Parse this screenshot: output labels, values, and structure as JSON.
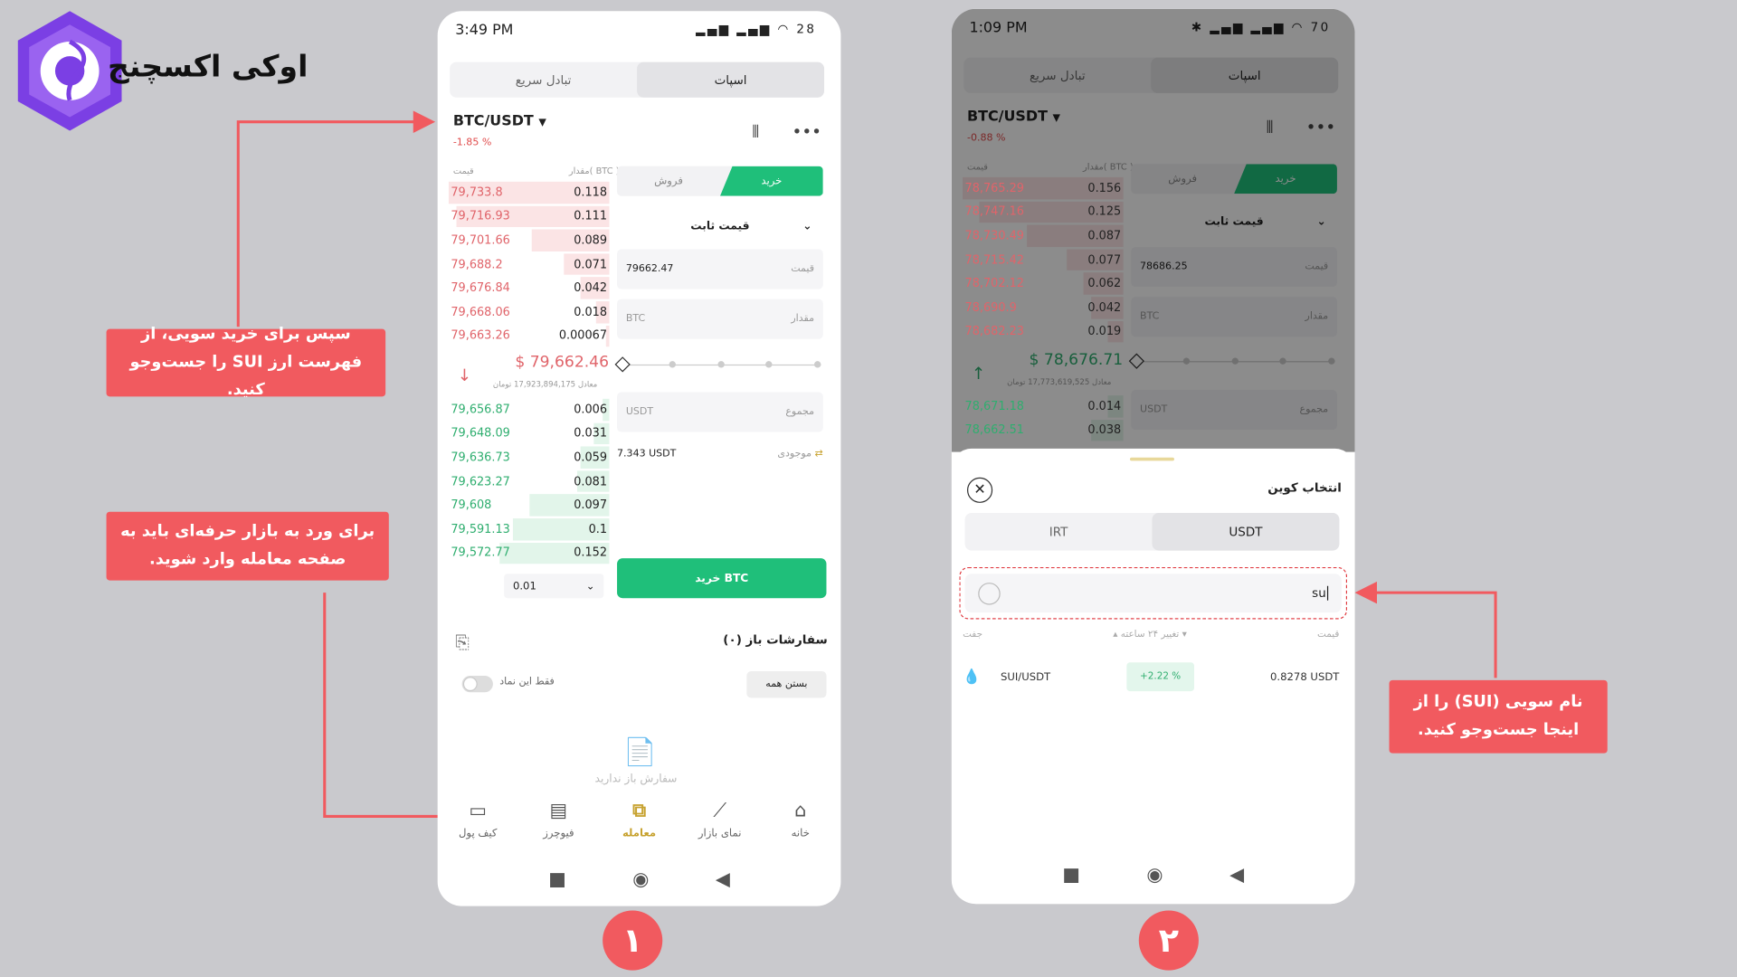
{
  "brand": {
    "name": "اوکی اکسچنج",
    "logo_icon": "okex-hexagon-logo"
  },
  "callouts": {
    "c1": "سپس برای خرید سویی، از فهرست ارز SUI را جست‌وجو کنید.",
    "c2": "برای ورد به بازار حرفه‌ای باید به صفحه معامله وارد شوید.",
    "c3": "نام سویی (SUI) را از اینجا جست‌وجو کنید."
  },
  "steps": {
    "one": "۱",
    "two": "۲"
  },
  "phone1": {
    "time": "3:49 PM",
    "battery": "28",
    "tabs": {
      "spot": "اسپات",
      "quick": "تبادل سریع"
    },
    "pair": "BTC/USDT",
    "change": "-1.85 %",
    "book_header": {
      "price": "قیمت",
      "amount": "مقدار( BTC )"
    },
    "asks": [
      {
        "p": "79,733.8",
        "q": "0.118",
        "w": 100
      },
      {
        "p": "79,716.93",
        "q": "0.111",
        "w": 95
      },
      {
        "p": "79,701.66",
        "q": "0.089",
        "w": 48
      },
      {
        "p": "79,688.2",
        "q": "0.071",
        "w": 28
      },
      {
        "p": "79,676.84",
        "q": "0.042",
        "w": 18
      },
      {
        "p": "79,668.06",
        "q": "0.018",
        "w": 8
      },
      {
        "p": "79,663.26",
        "q": "0.00067",
        "w": 2
      }
    ],
    "mid_price": "$ 79,662.46",
    "mid_sub": "معادل 17,923,894,175 تومان",
    "bids": [
      {
        "p": "79,656.87",
        "q": "0.006",
        "w": 4
      },
      {
        "p": "79,648.09",
        "q": "0.031",
        "w": 10
      },
      {
        "p": "79,636.73",
        "q": "0.059",
        "w": 18
      },
      {
        "p": "79,623.27",
        "q": "0.081",
        "w": 20
      },
      {
        "p": "79,608",
        "q": "0.097",
        "w": 50
      },
      {
        "p": "79,591.13",
        "q": "0.1",
        "w": 60
      },
      {
        "p": "79,572.77",
        "q": "0.152",
        "w": 68
      }
    ],
    "depth": "0.01",
    "trade_tabs": {
      "buy": "خرید",
      "sell": "فروش"
    },
    "order_type": "قیمت ثابت",
    "price_label": "قیمت",
    "price_value": "79662.47",
    "amount_label": "مقدار",
    "amount_unit": "BTC",
    "total_label": "مجموع",
    "total_unit": "USDT",
    "balance_label": "موجودی",
    "balance_value": "7.343 USDT",
    "buy_button": "خرید BTC",
    "open_orders": "سفارشات باز (۰)",
    "only_symbol": "فقط این نماد",
    "close_all": "بستن همه",
    "empty": "سفارش باز ندارید",
    "nav": [
      {
        "label": "خانه",
        "icon": "home-icon"
      },
      {
        "label": "نمای بازار",
        "icon": "chart-icon"
      },
      {
        "label": "معامله",
        "icon": "trade-icon"
      },
      {
        "label": "فیوچرز",
        "icon": "futures-icon"
      },
      {
        "label": "کیف پول",
        "icon": "wallet-icon"
      }
    ]
  },
  "phone2": {
    "time": "1:09 PM",
    "battery": "70",
    "tabs": {
      "spot": "اسپات",
      "quick": "تبادل سریع"
    },
    "pair": "BTC/USDT",
    "change": "-0.88 %",
    "book_header": {
      "price": "قیمت",
      "amount": "مقدار( BTC )"
    },
    "asks": [
      {
        "p": "78,765.29",
        "q": "0.156",
        "w": 100
      },
      {
        "p": "78,747.16",
        "q": "0.125",
        "w": 90
      },
      {
        "p": "78,730.49",
        "q": "0.087",
        "w": 60
      },
      {
        "p": "78,715.42",
        "q": "0.077",
        "w": 35
      },
      {
        "p": "78,702.12",
        "q": "0.062",
        "w": 25
      },
      {
        "p": "78,690.9",
        "q": "0.042",
        "w": 20
      },
      {
        "p": "78,682.23",
        "q": "0.019",
        "w": 10
      }
    ],
    "mid_price": "$ 78,676.71",
    "mid_sub": "معادل 17,773,619,525 تومان",
    "bids": [
      {
        "p": "78,671.18",
        "q": "0.014",
        "w": 10
      },
      {
        "p": "78,662.51",
        "q": "0.038",
        "w": 20
      }
    ],
    "trade_tabs": {
      "buy": "خرید",
      "sell": "فروش"
    },
    "order_type": "قیمت ثابت",
    "price_label": "قیمت",
    "price_value": "78686.25",
    "amount_label": "مقدار",
    "amount_unit": "BTC",
    "total_label": "مجموع",
    "total_unit": "USDT",
    "sheet": {
      "title": "انتخاب کوین",
      "tabs": {
        "usdt": "USDT",
        "irt": "IRT"
      },
      "search_value": "su",
      "cols": {
        "pair": "جفت",
        "change": "تغییر ۲۴ ساعته",
        "price": "قیمت"
      },
      "result": {
        "pair": "SUI/USDT",
        "change": "+2.22 %",
        "price": "0.8278 USDT"
      }
    }
  },
  "colors": {
    "accent": "#f15a5f",
    "buy": "#1fbf7a",
    "ask": "#e0646a",
    "bid": "#2fae6f",
    "active_nav": "#c7a22f"
  }
}
